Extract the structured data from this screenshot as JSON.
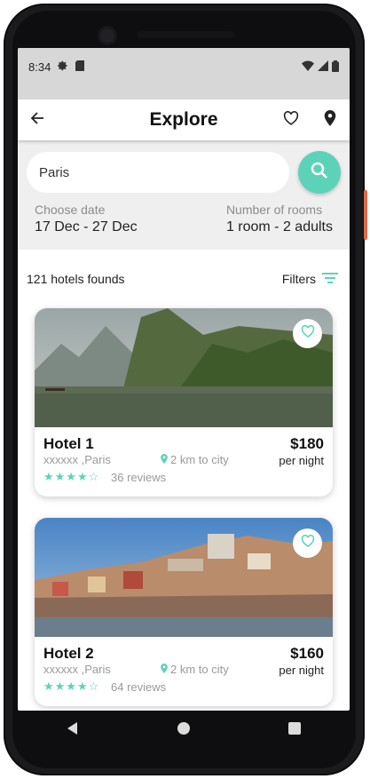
{
  "status": {
    "time": "8:34"
  },
  "appbar": {
    "title": "Explore",
    "back_icon": "arrow-left-icon",
    "fav_icon": "heart-outline-icon",
    "map_icon": "location-pin-icon"
  },
  "search": {
    "value": "Paris",
    "placeholder": "Paris",
    "button_icon": "search-icon"
  },
  "date": {
    "label": "Choose date",
    "value": "17 Dec - 27 Dec"
  },
  "rooms": {
    "label": "Number of rooms",
    "value": "1 room - 2 adults"
  },
  "results": {
    "count_text": "121 hotels founds",
    "filters_label": "Filters"
  },
  "hotels": [
    {
      "name": "Hotel 1",
      "location": "xxxxxx ,Paris",
      "distance": "2 km to city",
      "stars": "★★★★☆",
      "reviews": "36 reviews",
      "price": "$180",
      "per": "per night"
    },
    {
      "name": "Hotel 2",
      "location": "xxxxxx ,Paris",
      "distance": "2 km to city",
      "stars": "★★★★☆",
      "reviews": "64 reviews",
      "price": "$160",
      "per": "per night"
    }
  ],
  "colors": {
    "accent": "#5cd3b9",
    "status_bar": "#d7d7d7",
    "search_bg": "#efefef"
  }
}
